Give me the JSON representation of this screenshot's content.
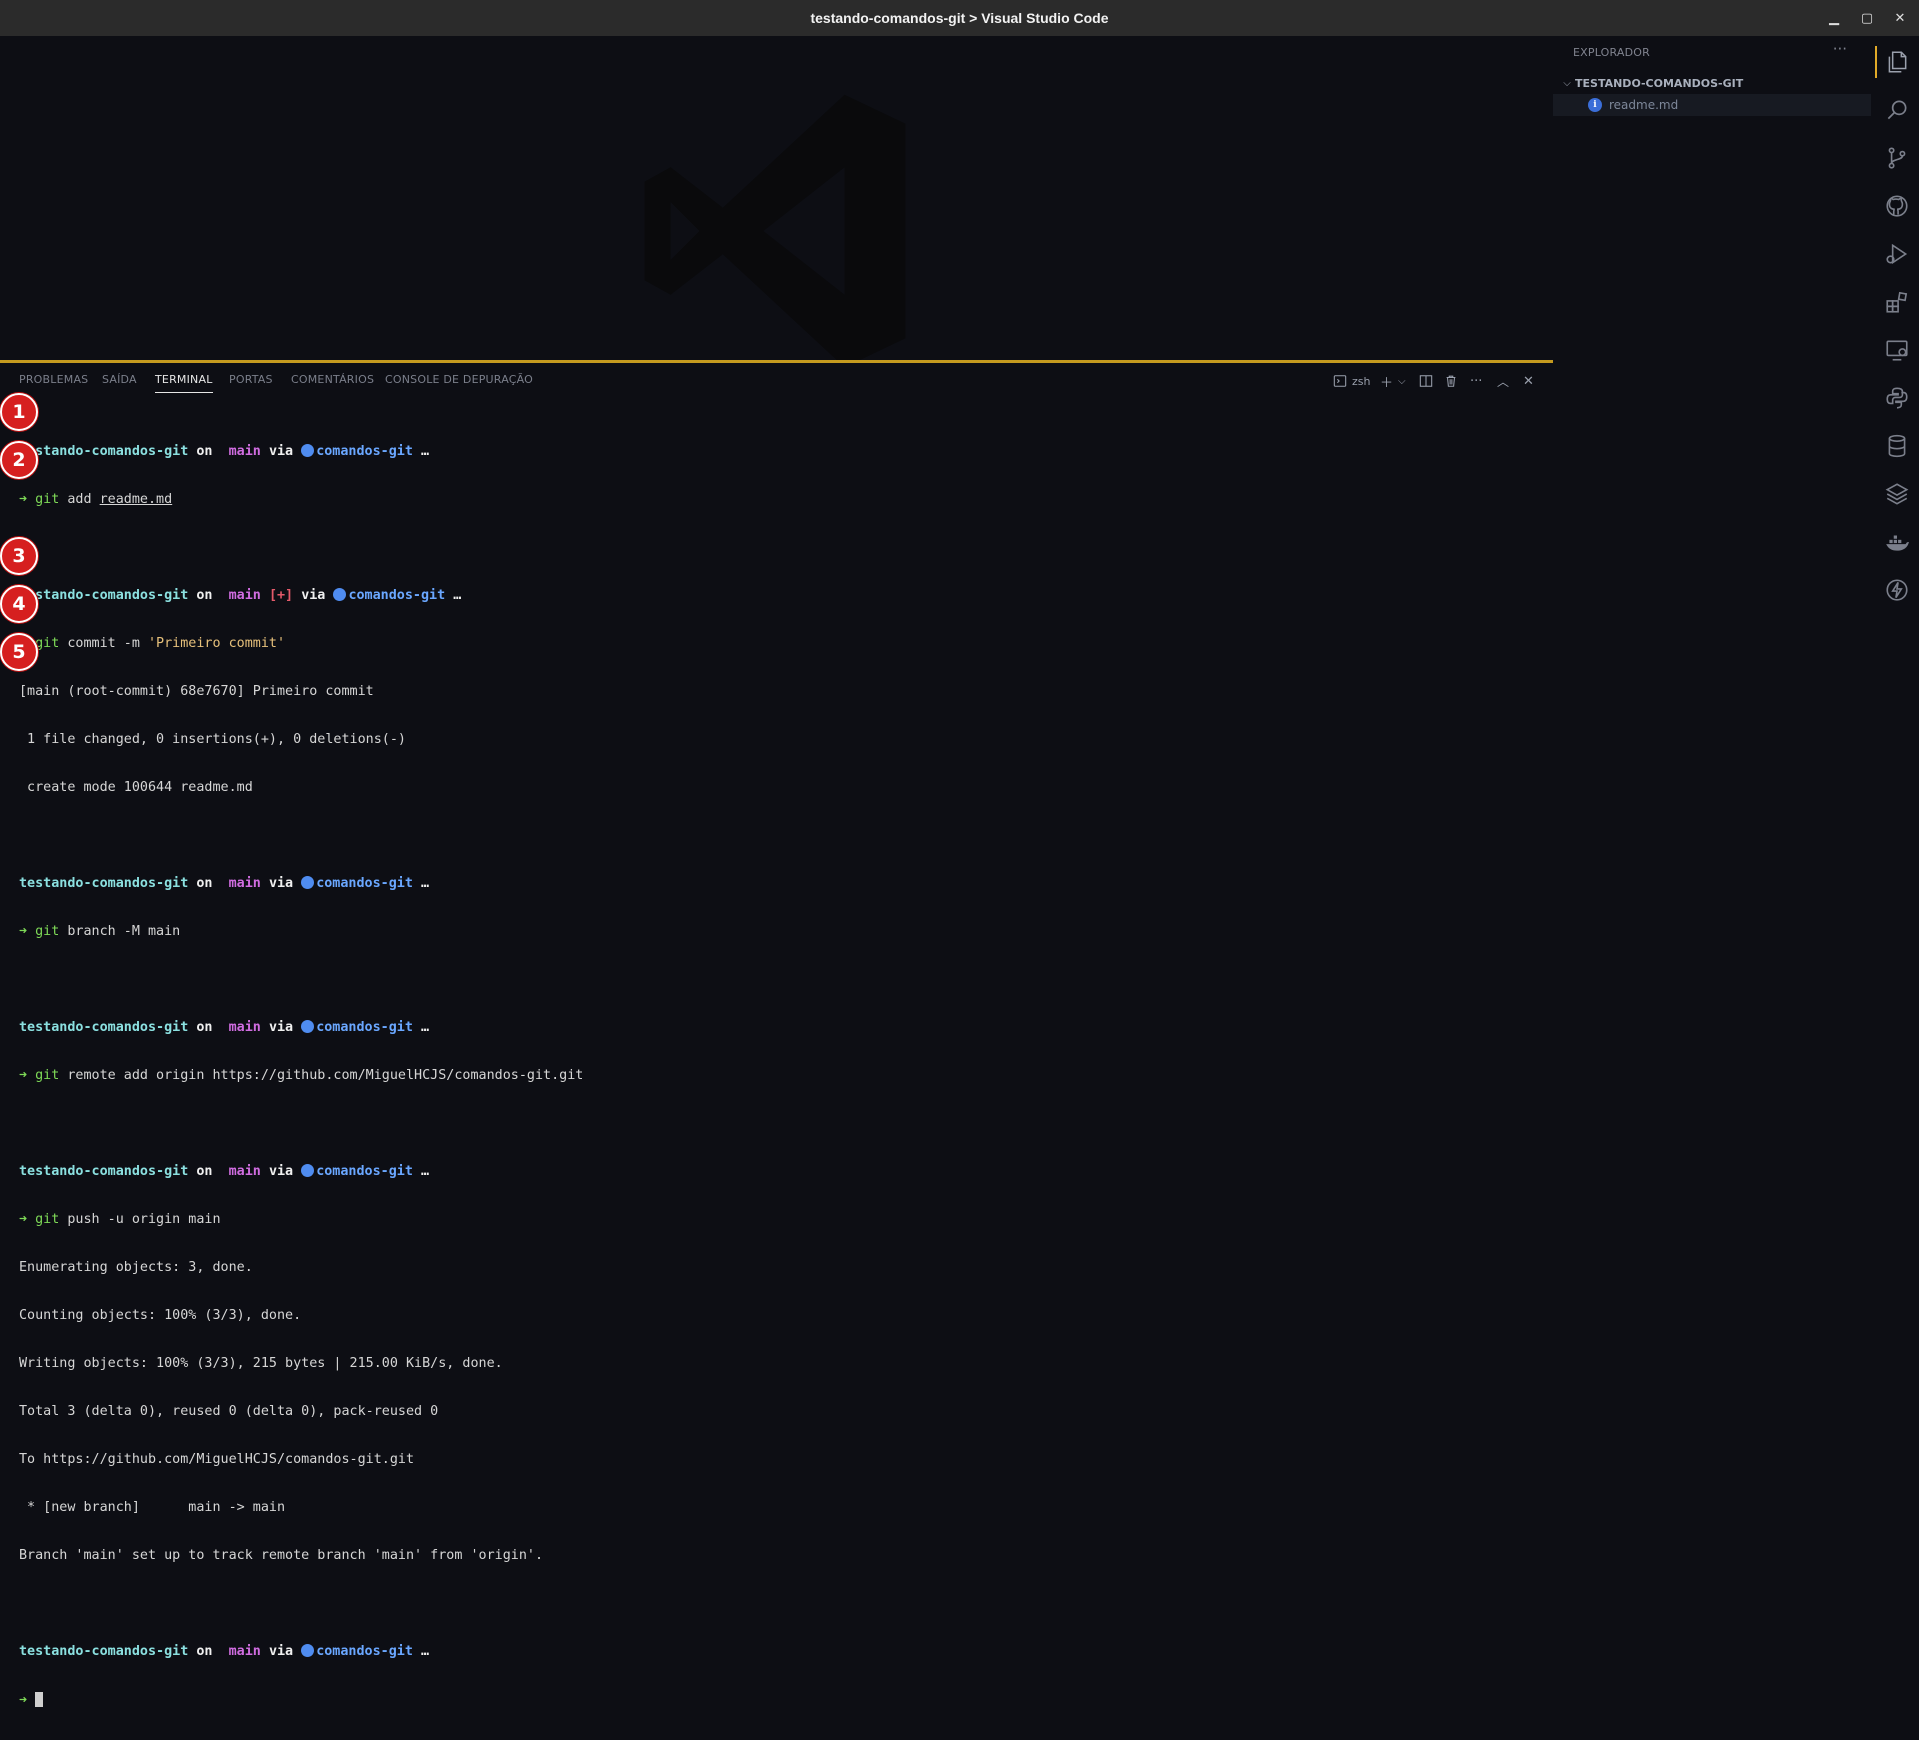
{
  "window": {
    "title": "testando-comandos-git > Visual Studio Code",
    "minimize": "▁",
    "maximize": "▢",
    "close": "✕"
  },
  "sidebar": {
    "header": "EXPLORADOR",
    "more": "···",
    "folder": "TESTANDO-COMANDOS-GIT",
    "files": [
      {
        "name": "readme.md",
        "icon": "info-icon",
        "glyph": "i"
      }
    ]
  },
  "activity_bar": [
    "explorer-icon",
    "search-icon",
    "source-control-icon",
    "github-icon",
    "run-debug-icon",
    "extensions-icon",
    "remote-explorer-icon",
    "python-icon",
    "database-icon",
    "layers-icon",
    "docker-icon",
    "lightning-icon"
  ],
  "panel": {
    "tabs": [
      "PROBLEMAS",
      "SAÍDA",
      "TERMINAL",
      "PORTAS",
      "COMENTÁRIOS",
      "CONSOLE DE DEPURAÇÃO"
    ],
    "active_tab": "TERMINAL",
    "shell": "zsh"
  },
  "prompt": {
    "dir": "testando-comandos-git",
    "on": "on",
    "branch_glyph": "",
    "branch": "main",
    "status": "[+]",
    "via": "via",
    "pkg": "comandos-git",
    "ellipsis": "…",
    "arrow": "➜"
  },
  "terminal": {
    "cmd1": {
      "git": "git",
      "rest": " add ",
      "arg": "readme.md"
    },
    "cmd2": {
      "git": "git",
      "rest": " commit -m ",
      "arg": "'Primeiro commit'"
    },
    "out2": [
      "[main (root-commit) 68e7670] Primeiro commit",
      " 1 file changed, 0 insertions(+), 0 deletions(-)",
      " create mode 100644 readme.md"
    ],
    "cmd3": {
      "git": "git",
      "rest": " branch -M main"
    },
    "cmd4": {
      "git": "git",
      "rest": " remote add origin https://github.com/MiguelHCJS/comandos-git.git"
    },
    "cmd5": {
      "git": "git",
      "rest": " push -u origin main"
    },
    "out5": [
      "Enumerating objects: 3, done.",
      "Counting objects: 100% (3/3), done.",
      "Writing objects: 100% (3/3), 215 bytes | 215.00 KiB/s, done.",
      "Total 3 (delta 0), reused 0 (delta 0), pack-reused 0",
      "To https://github.com/MiguelHCJS/comandos-git.git",
      " * [new branch]      main -> main",
      "Branch 'main' set up to track remote branch 'main' from 'origin'."
    ]
  },
  "badges": [
    "1",
    "2",
    "3",
    "4",
    "5"
  ],
  "colors": {
    "accent": "#c49a1f",
    "badge": "#d61f1f",
    "dir": "#8be0e0",
    "branch": "#d06ce0",
    "pkg": "#6aa7ff",
    "arrow": "#7ed957"
  }
}
